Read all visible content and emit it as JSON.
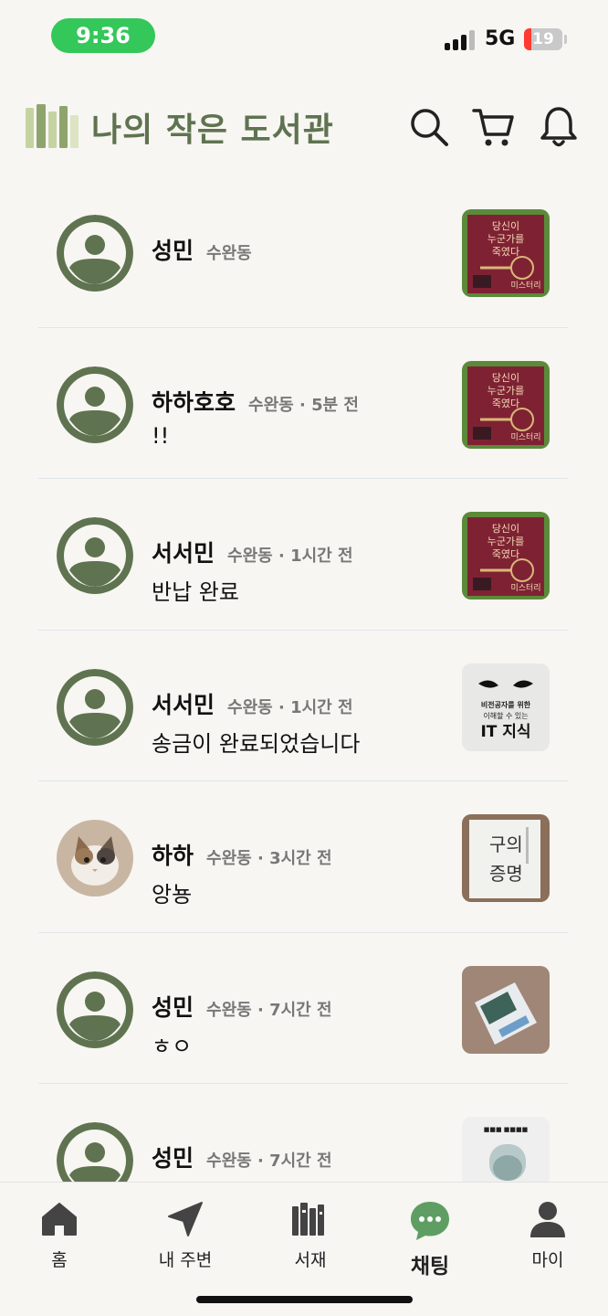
{
  "status": {
    "time": "9:36",
    "network": "5G",
    "battery": "19",
    "battery_level": 0.19
  },
  "header": {
    "title": "나의 작은 도서관",
    "icons": [
      "logo-books-icon",
      "search-icon",
      "cart-icon",
      "bell-icon"
    ],
    "accent": "#5f7350"
  },
  "chats": [
    {
      "name": "성민",
      "meta": "수완동",
      "message": "",
      "avatar": "default",
      "thumb": "book-red-key"
    },
    {
      "name": "하하호호",
      "meta": "수완동 · 5분 전",
      "message": "!!",
      "avatar": "default",
      "thumb": "book-red-key"
    },
    {
      "name": "서서민",
      "meta": "수완동 · 1시간 전",
      "message": "반납 완료",
      "avatar": "default",
      "thumb": "book-red-key"
    },
    {
      "name": "서서민",
      "meta": "수완동 · 1시간 전",
      "message": "송금이 완료되었습니다",
      "avatar": "default",
      "thumb": "book-it"
    },
    {
      "name": "하하",
      "meta": "수완동 · 3시간 전",
      "message": "앙뇽",
      "avatar": "cat",
      "thumb": "book-white"
    },
    {
      "name": "성민",
      "meta": "수완동 · 7시간 전",
      "message": "ㅎㅇ",
      "avatar": "default",
      "thumb": "book-photo"
    },
    {
      "name": "성민",
      "meta": "수완동 · 7시간 전",
      "message": "",
      "avatar": "default",
      "thumb": "book-tiger"
    }
  ],
  "nav": [
    {
      "label": "홈",
      "icon": "home-icon"
    },
    {
      "label": "내 주변",
      "icon": "location-arrow-icon"
    },
    {
      "label": "서재",
      "icon": "bookshelf-icon"
    },
    {
      "label": "채팅",
      "icon": "chat-bubble-icon",
      "active": true
    },
    {
      "label": "마이",
      "icon": "person-icon"
    }
  ],
  "colors": {
    "avatar": "#5f7350",
    "chat_active": "#5f9e63",
    "background": "#f7f6f2"
  }
}
